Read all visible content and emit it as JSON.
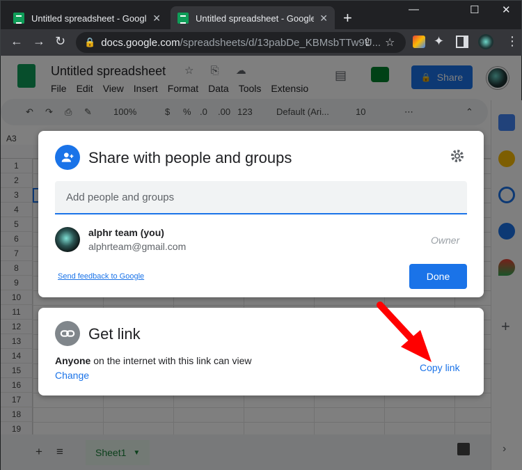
{
  "browser": {
    "tabs": [
      {
        "title": "Untitled spreadsheet - Google Sh"
      },
      {
        "title": "Untitled spreadsheet - Google Sh"
      }
    ],
    "tab_close": "✕",
    "new_tab": "+",
    "window_controls": {
      "minimize": "—",
      "maximize": "☐",
      "close": "✕"
    },
    "url_domain": "docs.google.com",
    "url_path": "/spreadsheets/d/13pabDe_KBMsbTTw9U..."
  },
  "sheets": {
    "title": "Untitled spreadsheet",
    "menu": [
      "File",
      "Edit",
      "View",
      "Insert",
      "Format",
      "Data",
      "Tools",
      "Extensio"
    ],
    "share_label": "Share",
    "toolbar": {
      "zoom": "100%",
      "currency": "$",
      "percent": "%",
      "dec_less": ".0",
      "dec_more": ".00",
      "number_format": "123",
      "font": "Default (Ari...",
      "font_size": "10"
    },
    "name_box": "A3",
    "rows": [
      "1",
      "2",
      "3",
      "4",
      "5",
      "6",
      "7",
      "8",
      "9",
      "10",
      "11",
      "12",
      "13",
      "14",
      "15",
      "16",
      "17",
      "18",
      "19"
    ],
    "sheet_tab": "Sheet1"
  },
  "share_dialog": {
    "title": "Share with people and groups",
    "add_placeholder": "Add people and groups",
    "person": {
      "name": "alphr team (you)",
      "email": "alphrteam@gmail.com",
      "role": "Owner"
    },
    "feedback": "Send feedback to Google",
    "done": "Done"
  },
  "link_dialog": {
    "title": "Get link",
    "audience": "Anyone",
    "description": "on the internet with this link can view",
    "change": "Change",
    "copy": "Copy link"
  },
  "colors": {
    "accent": "#1a73e8",
    "annotation_arrow": "#ff0000",
    "sheets_green": "#0f9d58"
  }
}
